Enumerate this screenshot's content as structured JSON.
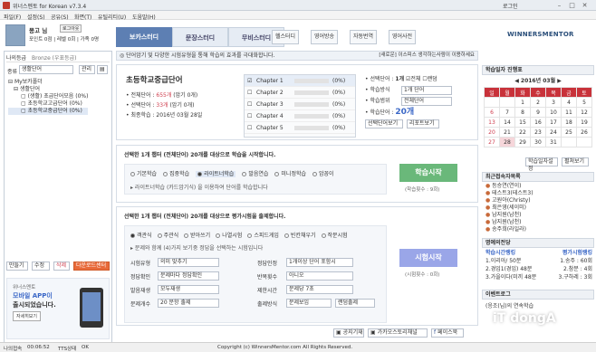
{
  "window": {
    "title": "위너스멘토 for Korean v7.3.4",
    "login_label": "로그인"
  },
  "menu": [
    "파일(F)",
    "설정(S)",
    "공유(S)",
    "화면(T)",
    "유틸리티(U)",
    "도움말(H)"
  ],
  "user": {
    "name": "몽고 님",
    "level_badge": "로그아웃",
    "line2": "포인트 0점 | 레벨 0회 | 가족 0명"
  },
  "tabs": [
    "보카스터디",
    "문장스터디",
    "무비스터디"
  ],
  "toolbar": [
    "헬스터디",
    "영어방송",
    "자동번역",
    "영어사전"
  ],
  "logo": "WINNERSMENTOR",
  "left": {
    "header_label": "나의등급",
    "grade": "Bronze (우표등급)",
    "category_label": "종류",
    "category_value": "생활단어",
    "manage_btn": "관리",
    "tree": [
      "My보카폴더",
      "생활단어",
      "(생활) 초급단어모음 (0%)",
      "초등학교고급단어 (0%)",
      "초등학교중급단어 (0%)"
    ],
    "buttons": [
      "만들기",
      "수정",
      "삭제",
      "다운로드센터"
    ],
    "promo": {
      "brand": "위너스멘토",
      "line1": "모바일 APP이",
      "line2": "출시되었습니다.",
      "cta": "자세히보기"
    }
  },
  "main": {
    "banner": "단어암기 및 다양한 시험유형을 통해 학습의 효과를 극대화합니다.",
    "banner_right": "[새로운] 이스피스  생각하는사람이 이용하세요",
    "book_title": "초등학교중급단어",
    "stats": [
      {
        "label": "전체단어",
        "value": "655개",
        "extra": "(암기 0개)"
      },
      {
        "label": "선택단어",
        "value": "33개",
        "extra": "(암기 0개)"
      },
      {
        "label": "최종학습",
        "value": "2016년 03월 28일",
        "extra": ""
      }
    ],
    "chapters": [
      {
        "name": "Chapter 1",
        "pct": "(0%)"
      },
      {
        "name": "Chapter 2",
        "pct": "(0%)"
      },
      {
        "name": "Chapter 3",
        "pct": "(0%)"
      },
      {
        "name": "Chapter 4",
        "pct": "(0%)"
      },
      {
        "name": "Chapter 5",
        "pct": "(0%)"
      }
    ],
    "options": {
      "select_words_label": "선택단어",
      "select_words_count": "1개",
      "all_label": "전체",
      "random_label": "랜덤",
      "study_order_label": "학습방식",
      "study_order_value": "1개 단어",
      "study_range_label": "학습범위",
      "study_range_value": "전체단어",
      "study_count_label": "학습단어",
      "study_count_value": "20개",
      "btn_select": "선택단어보기",
      "btn_report": "리포트보기"
    },
    "study": {
      "heading": "선택한 1개 챕터 (전체단어) 20개를 대상으로 학습을 시작합니다.",
      "modes": [
        "기본학습",
        "집중학습",
        "라이트너학습",
        "발음연습",
        "미니정학습",
        "암꽁이"
      ],
      "desc": "라이트너학습 (카드암기식) 을 이용하여 단어를 학습합니다",
      "start_btn": "학습시작",
      "start_sub": "(학습횟수 : 9회)"
    },
    "test": {
      "heading": "선택한 1개 챕터 (전체단어) 20개를 대상으로 평가시험을 출제합니다.",
      "types": [
        "객관식",
        "주관식",
        "받아쓰기",
        "나열시험",
        "스피드게임",
        "빈칸채우기",
        "작문시험"
      ],
      "desc": "문제와 함께 (4)가지 보기중 정답을 선택하는 시험입니다",
      "rows": [
        {
          "l1": "시험유형",
          "v1": "의미 맞추기",
          "l2": "정답인정",
          "v2": "1개이상 단어 포함시"
        },
        {
          "l1": "정답확인",
          "v1": "문제마다 정답확인",
          "l2": "반복횟수",
          "v2": "아니오"
        },
        {
          "l1": "발음재생",
          "v1": "모두재생",
          "l2": "제한시간",
          "v2": "문제당 7초"
        },
        {
          "l1": "문제개수",
          "v1": "20 문항 출제",
          "l2": "출제방식",
          "v2": "문제보임",
          "v3": "랜덤출제"
        }
      ],
      "start_btn": "시험시작",
      "start_sub": "(시험횟수 : 0회)"
    },
    "footer_btns": [
      "공지기재",
      "가카오스토리채널",
      "페이스북"
    ]
  },
  "right": {
    "calendar_title": "학습일자 진행표",
    "month": "2016년 03월",
    "weekdays": [
      "일",
      "월",
      "화",
      "수",
      "목",
      "금",
      "토"
    ],
    "weeks": [
      [
        "",
        "",
        "1",
        "2",
        "3",
        "4",
        "5"
      ],
      [
        "6",
        "7",
        "8",
        "9",
        "10",
        "11",
        "12"
      ],
      [
        "13",
        "14",
        "15",
        "16",
        "17",
        "18",
        "19"
      ],
      [
        "20",
        "21",
        "22",
        "23",
        "24",
        "25",
        "26"
      ],
      [
        "27",
        "28",
        "29",
        "30",
        "31",
        "",
        ""
      ]
    ],
    "cal_btns": [
      "학습일자설정",
      "펼쳐보기"
    ],
    "recent_title": "최근접속자목록",
    "recent": [
      "등승연(연이)",
      "테스트3(테스트3)",
      "고원아(Christy)",
      "최은영(세이미)",
      "남지원(남천)",
      "남지원(남천)",
      "송주희(라일라)"
    ],
    "rank_title": "명예의전당",
    "rank_h1": "학습시간랭킹",
    "rank_h2": "평가시험랭킹",
    "rank_rows": [
      [
        "1.이리아/ 50분",
        "1.송주 : 60회"
      ],
      [
        "2.경임1(경임) 48분",
        "2.참분 : 4회"
      ],
      [
        "3.가을이다(미끼 48분",
        "3.구하레 : 3회"
      ]
    ],
    "event_title": "이벤트로그",
    "event_text": "(응조(님)의 연속학습"
  },
  "status": {
    "time_label": "나의접속",
    "time": "00:06:52",
    "tts_label": "TTS상태",
    "tts": "OK",
    "copyright": "Copyright (c) WinnersMentor.com All Rights Reserved."
  },
  "watermark": "iT dongA"
}
